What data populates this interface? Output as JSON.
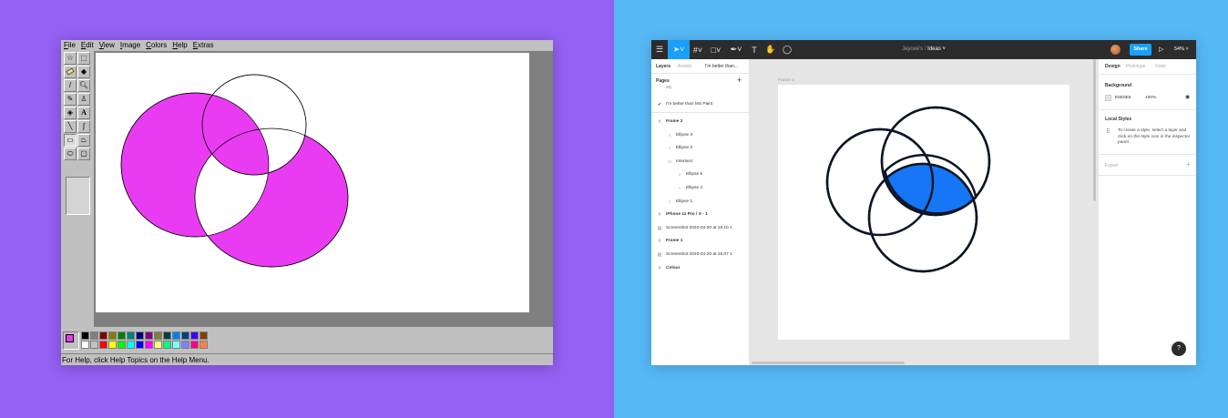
{
  "paint": {
    "menu": [
      "File",
      "Edit",
      "View",
      "Image",
      "Colors",
      "Help",
      "Extras"
    ],
    "status_text": "For Help, click Help Topics on the Help Menu.",
    "tools": [
      "free-select",
      "rect-select",
      "eraser",
      "fill",
      "color-picker",
      "magnifier",
      "pencil",
      "brush",
      "airbrush",
      "text",
      "line",
      "curve",
      "rectangle",
      "polygon",
      "ellipse",
      "rounded-rectangle"
    ],
    "palette_top": [
      "#000000",
      "#808080",
      "#800000",
      "#808000",
      "#008000",
      "#008080",
      "#000080",
      "#800080",
      "#808040",
      "#004040",
      "#0080ff",
      "#004080",
      "#4000ff",
      "#804000"
    ],
    "palette_bottom": [
      "#ffffff",
      "#c0c0c0",
      "#ff0000",
      "#ffff00",
      "#00ff00",
      "#00ffff",
      "#0000ff",
      "#ff00ff",
      "#ffff80",
      "#00ff80",
      "#80ffff",
      "#8080ff",
      "#ff0080",
      "#ff8040"
    ],
    "fill_color": "#e93cf2"
  },
  "figma": {
    "file_owner": "Jaycee's",
    "file_sep": "/",
    "file_name": "Ideas",
    "share_label": "Share",
    "zoom": "54%",
    "left_tabs": [
      "Layers",
      "Assets",
      "I'm better than..."
    ],
    "pages_heading": "Pages",
    "pages_cut": "My",
    "current_page": "I'm better than MS Paint",
    "layers": [
      {
        "label": "Frame 2",
        "kind": "frame",
        "bold": true
      },
      {
        "label": "Ellipse 3",
        "kind": "ellipse"
      },
      {
        "label": "Ellipse 2",
        "kind": "ellipse"
      },
      {
        "label": "Intersect",
        "kind": "boolean"
      },
      {
        "label": "Ellipse 5",
        "kind": "ellipse"
      },
      {
        "label": "Ellipse 4",
        "kind": "ellipse"
      },
      {
        "label": "Ellipse 1",
        "kind": "ellipse"
      },
      {
        "label": "iPhone 11 Pro / X - 1",
        "kind": "frame",
        "bold": true
      },
      {
        "label": "Screenshot 2020-04-20 at 18.10 1",
        "kind": "image"
      },
      {
        "label": "Frame 1",
        "kind": "frame",
        "bold": true
      },
      {
        "label": "Screenshot 2020-04-20 at 18.07 1",
        "kind": "image"
      },
      {
        "label": "Colour",
        "kind": "frame",
        "bold": true
      }
    ],
    "frame_label": "Frame 2",
    "right_tabs": [
      "Design",
      "Prototype",
      "Code"
    ],
    "background_heading": "Background",
    "background_hex": "E5E5E5",
    "background_opacity": "100%",
    "local_styles_heading": "Local Styles",
    "local_styles_hint": "To create a style, select a layer and click on the style icon in the inspector panel.",
    "export_heading": "Export",
    "help_label": "?",
    "accent": "#18a0fb",
    "intersect_fill": "#1776f5"
  }
}
